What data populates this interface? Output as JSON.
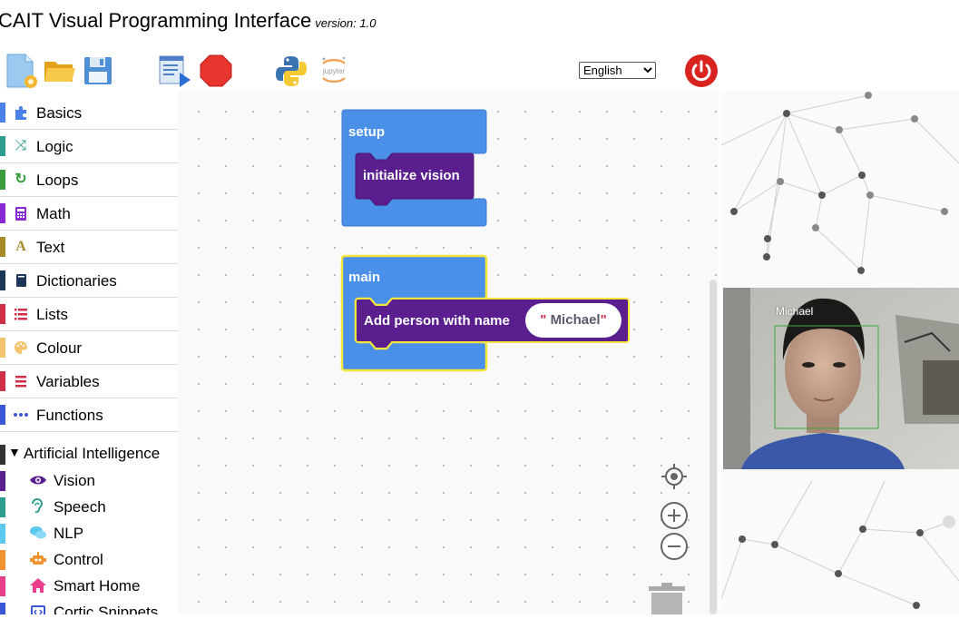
{
  "header": {
    "title": "CAIT Visual Programming Interface",
    "version": "version: 1.0"
  },
  "toolbar": {
    "language_selected": "English",
    "language_options": [
      "English"
    ]
  },
  "toolbox": {
    "categories": [
      {
        "label": "Basics",
        "color": "#4a80e8",
        "icon": "puzzle-icon"
      },
      {
        "label": "Logic",
        "color": "#2e9e8f",
        "icon": "shuffle-icon"
      },
      {
        "label": "Loops",
        "color": "#3a9c3a",
        "icon": "loop-icon"
      },
      {
        "label": "Math",
        "color": "#8a2ad6",
        "icon": "calculator-icon"
      },
      {
        "label": "Text",
        "color": "#a58a2a",
        "icon": "text-icon"
      },
      {
        "label": "Dictionaries",
        "color": "#1d3557",
        "icon": "book-icon"
      },
      {
        "label": "Lists",
        "color": "#d12f47",
        "icon": "list-icon"
      },
      {
        "label": "Colour",
        "color": "#f2c46d",
        "icon": "palette-icon"
      },
      {
        "label": "Variables",
        "color": "#d12f47",
        "icon": "variables-icon"
      },
      {
        "label": "Functions",
        "color": "#3a58d6",
        "icon": "dots-icon"
      }
    ],
    "ai_header": "Artificial Intelligence",
    "ai_items": [
      {
        "label": "Vision",
        "color": "#5b1e8f",
        "icon": "eye-icon"
      },
      {
        "label": "Speech",
        "color": "#2e9e8f",
        "icon": "ear-icon"
      },
      {
        "label": "NLP",
        "color": "#5bc8f0",
        "icon": "chat-icon"
      },
      {
        "label": "Control",
        "color": "#f0932e",
        "icon": "robot-icon"
      },
      {
        "label": "Smart Home",
        "color": "#e83e8c",
        "icon": "home-icon"
      },
      {
        "label": "Cortic Snippets",
        "color": "#3a58d6",
        "icon": "code-icon"
      }
    ]
  },
  "blocks": {
    "setup_label": "setup",
    "init_vision_label": "initialize vision",
    "main_label": "main",
    "add_person_label": "Add person with name",
    "person_name_value": "Michael",
    "quote_open": "\"",
    "quote_close": "\""
  },
  "camera": {
    "detected_name": "Michael"
  },
  "colors": {
    "block_blue": "#4a8fe8",
    "block_purple": "#5b1e8f",
    "highlight_yellow": "#f5e63c",
    "stop_red": "#e8352d",
    "power_red": "#d9231f"
  }
}
